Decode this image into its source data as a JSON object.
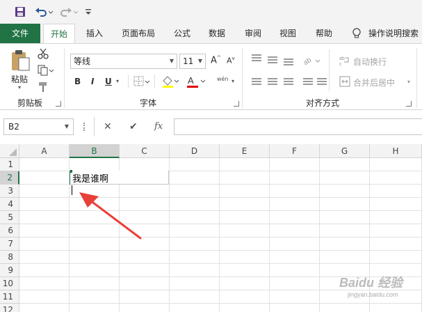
{
  "tabs": [
    "文件",
    "开始",
    "插入",
    "页面布局",
    "公式",
    "数据",
    "审阅",
    "视图",
    "帮助"
  ],
  "tell_me": "操作说明搜索",
  "clipboard": {
    "paste_label": "粘贴",
    "group_label": "剪贴板"
  },
  "font": {
    "name": "等线",
    "size": "11",
    "group_label": "字体",
    "bold": "B",
    "italic": "I",
    "underline": "U",
    "phonetic": "wén"
  },
  "alignment": {
    "wrap_text": "自动换行",
    "merge_center": "合并后居中",
    "group_label": "对齐方式"
  },
  "formula_bar": {
    "name_box": "B2",
    "fx": "fx",
    "value": ""
  },
  "columns": [
    "A",
    "B",
    "C",
    "D",
    "E",
    "F",
    "G",
    "H"
  ],
  "rows": [
    "1",
    "2",
    "3",
    "4",
    "5",
    "6",
    "7",
    "8",
    "9",
    "10",
    "11",
    "12"
  ],
  "cells": {
    "B2": "我是谁啊"
  },
  "selected_cell": "B2",
  "watermark": "Baidu 经验",
  "watermark_url": "jingyan.baidu.com",
  "colors": {
    "excel_green": "#217346",
    "annotation_arrow": "#e8413a"
  }
}
